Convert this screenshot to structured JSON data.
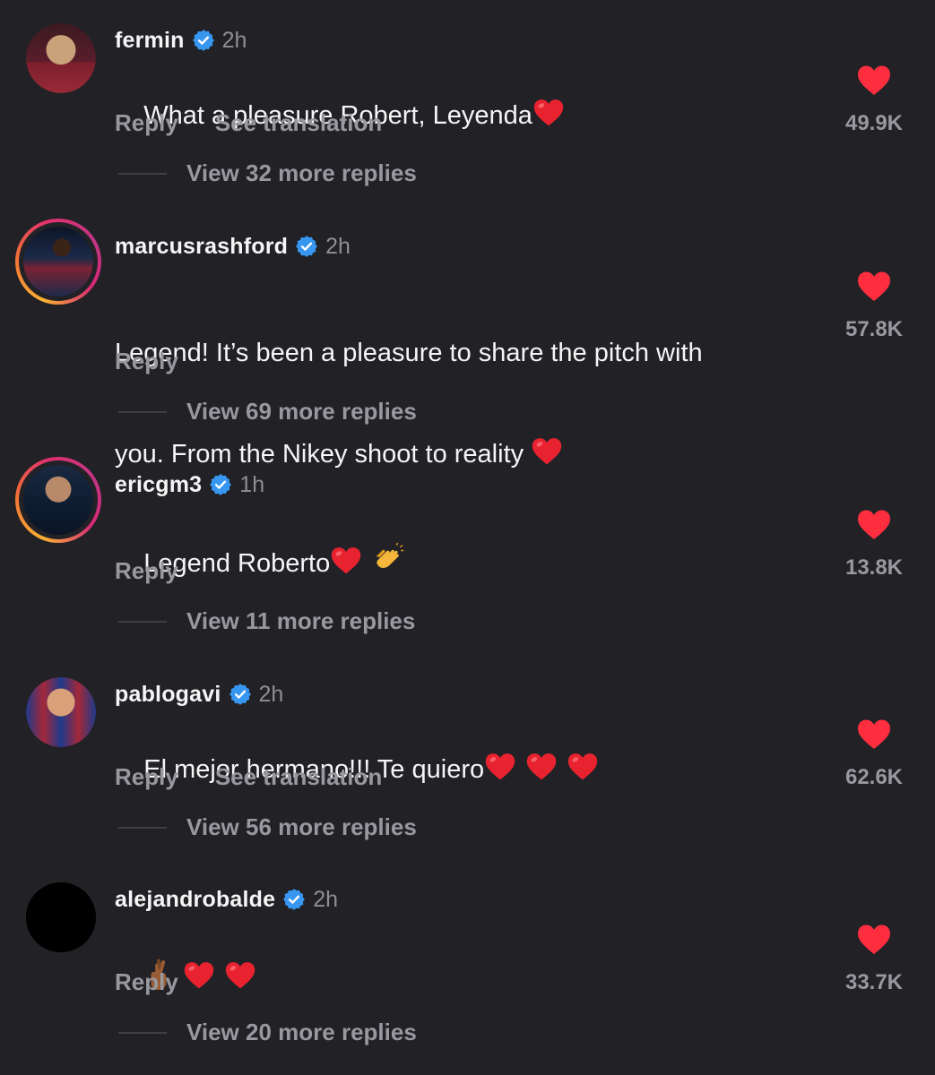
{
  "comments": [
    {
      "username": "fermin",
      "time": "2h",
      "text": "What a pleasure Robert, Leyenda",
      "emojis": [
        "red-heart-emoji"
      ],
      "actions": [
        "Reply",
        "See translation"
      ],
      "likes": "49.9K",
      "replies": "View 32 more replies",
      "avatar_story_ring": false,
      "avatar_colors": [
        "#7b1e2c",
        "#c9a27a",
        "#3b1a20"
      ]
    },
    {
      "username": "marcusrashford",
      "time": "2h",
      "text_lines": [
        "Legend! It’s been a pleasure to share the pitch with",
        "you. From the Nikey shoot to reality "
      ],
      "emojis": [
        "red-heart-emoji"
      ],
      "actions": [
        "Reply"
      ],
      "likes": "57.8K",
      "replies": "View 69 more replies",
      "avatar_story_ring": true,
      "avatar_colors": [
        "#1c2a4a",
        "#7a2233",
        "#0d1526"
      ]
    },
    {
      "username": "ericgm3",
      "time": "1h",
      "text": "Legend Roberto",
      "emojis": [
        "red-heart-emoji",
        "clapping-hands-emoji"
      ],
      "actions": [
        "Reply"
      ],
      "likes": "13.8K",
      "replies": "View 11 more replies",
      "avatar_story_ring": true,
      "avatar_colors": [
        "#0f1e33",
        "#b88a6a",
        "#1a2840"
      ]
    },
    {
      "username": "pablogavi",
      "time": "2h",
      "text": "El mejor hermano!!! Te quiero",
      "emojis": [
        "red-heart-emoji",
        "red-heart-emoji",
        "red-heart-emoji"
      ],
      "actions": [
        "Reply",
        "See translation"
      ],
      "likes": "62.6K",
      "replies": "View 56 more replies",
      "avatar_story_ring": false,
      "avatar_colors": [
        "#a3283a",
        "#d9a07a",
        "#1e3a8a"
      ]
    },
    {
      "username": "alejandrobalde",
      "time": "2h",
      "text": "",
      "emojis": [
        "crossed-fingers-emoji",
        "red-heart-emoji",
        "red-heart-emoji"
      ],
      "actions": [
        "Reply"
      ],
      "likes": "33.7K",
      "replies": "View 20 more replies",
      "avatar_story_ring": false,
      "avatar_colors": [
        "#000000",
        "#000000",
        "#000000"
      ]
    }
  ],
  "colors": {
    "background": "#212126",
    "like_heart": "#ff2e3f",
    "verified_badge": "#3797f0",
    "secondary_text": "#98989f"
  }
}
